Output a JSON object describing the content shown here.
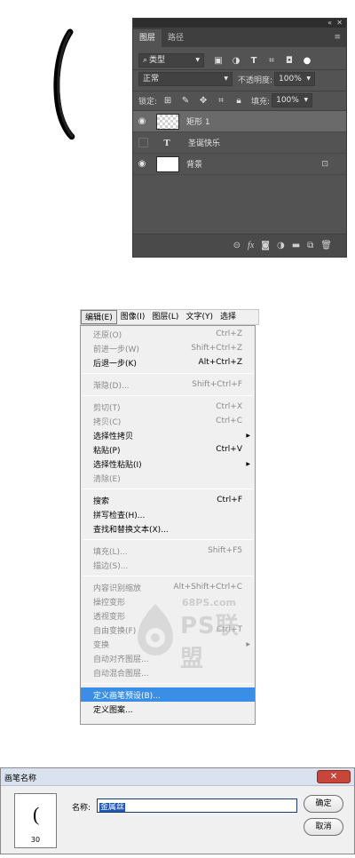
{
  "layers_panel": {
    "collapse_glyph": "«",
    "close_glyph": "✕",
    "tabs": [
      "图层",
      "路径"
    ],
    "filter_kind": "类型",
    "blend_mode": "正常",
    "opacity_label": "不透明度:",
    "opacity_value": "100%",
    "lock_label": "锁定:",
    "fill_label": "填充:",
    "fill_value": "100%",
    "layers": [
      {
        "name": "矩形 1",
        "visible": true,
        "selected": true,
        "kind": "shape"
      },
      {
        "name": "圣诞快乐",
        "visible": false,
        "selected": false,
        "kind": "text"
      },
      {
        "name": "背景",
        "visible": true,
        "selected": false,
        "kind": "background",
        "locked": true
      }
    ],
    "bottom_icons": [
      "link-icon",
      "fx-icon",
      "mask-icon",
      "adjustment-icon",
      "group-folder-icon",
      "new-layer-icon",
      "trash-icon"
    ]
  },
  "menubar": {
    "items": [
      "编辑(E)",
      "图像(I)",
      "图层(L)",
      "文字(Y)",
      "选择"
    ]
  },
  "edit_menu": {
    "items": [
      {
        "label": "还原(O)",
        "shortcut": "Ctrl+Z",
        "disabled": true
      },
      {
        "label": "前进一步(W)",
        "shortcut": "Shift+Ctrl+Z",
        "disabled": true
      },
      {
        "label": "后退一步(K)",
        "shortcut": "Alt+Ctrl+Z",
        "disabled": false
      },
      {
        "label": "渐隐(D)...",
        "shortcut": "Shift+Ctrl+F",
        "disabled": true
      },
      {
        "label": "剪切(T)",
        "shortcut": "Ctrl+X",
        "disabled": true
      },
      {
        "label": "拷贝(C)",
        "shortcut": "Ctrl+C",
        "disabled": true
      },
      {
        "label": "选择性拷贝",
        "shortcut": "",
        "disabled": false,
        "submenu": true
      },
      {
        "label": "粘贴(P)",
        "shortcut": "Ctrl+V",
        "disabled": false
      },
      {
        "label": "选择性粘贴(I)",
        "shortcut": "",
        "disabled": false,
        "submenu": true
      },
      {
        "label": "清除(E)",
        "shortcut": "",
        "disabled": true
      },
      {
        "label": "搜索",
        "shortcut": "Ctrl+F",
        "disabled": false
      },
      {
        "label": "拼写检查(H)...",
        "shortcut": "",
        "disabled": false
      },
      {
        "label": "查找和替换文本(X)...",
        "shortcut": "",
        "disabled": false
      },
      {
        "label": "填充(L)...",
        "shortcut": "Shift+F5",
        "disabled": true
      },
      {
        "label": "描边(S)...",
        "shortcut": "",
        "disabled": true
      },
      {
        "label": "内容识别缩放",
        "shortcut": "Alt+Shift+Ctrl+C",
        "disabled": true
      },
      {
        "label": "操控变形",
        "shortcut": "",
        "disabled": true
      },
      {
        "label": "透视变形",
        "shortcut": "",
        "disabled": true
      },
      {
        "label": "自由变换(F)",
        "shortcut": "Ctrl+T",
        "disabled": true
      },
      {
        "label": "变换",
        "shortcut": "",
        "disabled": true,
        "submenu": true
      },
      {
        "label": "自动对齐图层...",
        "shortcut": "",
        "disabled": true
      },
      {
        "label": "自动混合图层...",
        "shortcut": "",
        "disabled": true
      },
      {
        "label": "定义画笔预设(B)...",
        "shortcut": "",
        "disabled": false,
        "highlighted": true
      },
      {
        "label": "定义图案...",
        "shortcut": "",
        "disabled": false
      }
    ]
  },
  "watermark": {
    "domain": "68PS.com",
    "brand": "PS联盟"
  },
  "dialog": {
    "title": "画笔名称",
    "close_glyph": "✕",
    "brush_glyph": "(",
    "brush_size": "30",
    "name_label": "名称:",
    "name_value": "金属丝",
    "ok_label": "确定",
    "cancel_label": "取消"
  },
  "colors": {
    "panel_bg": "#535353",
    "panel_selected": "#6a6a6a",
    "menu_highlight": "#3a8ee6",
    "close_button": "#c8453a"
  }
}
